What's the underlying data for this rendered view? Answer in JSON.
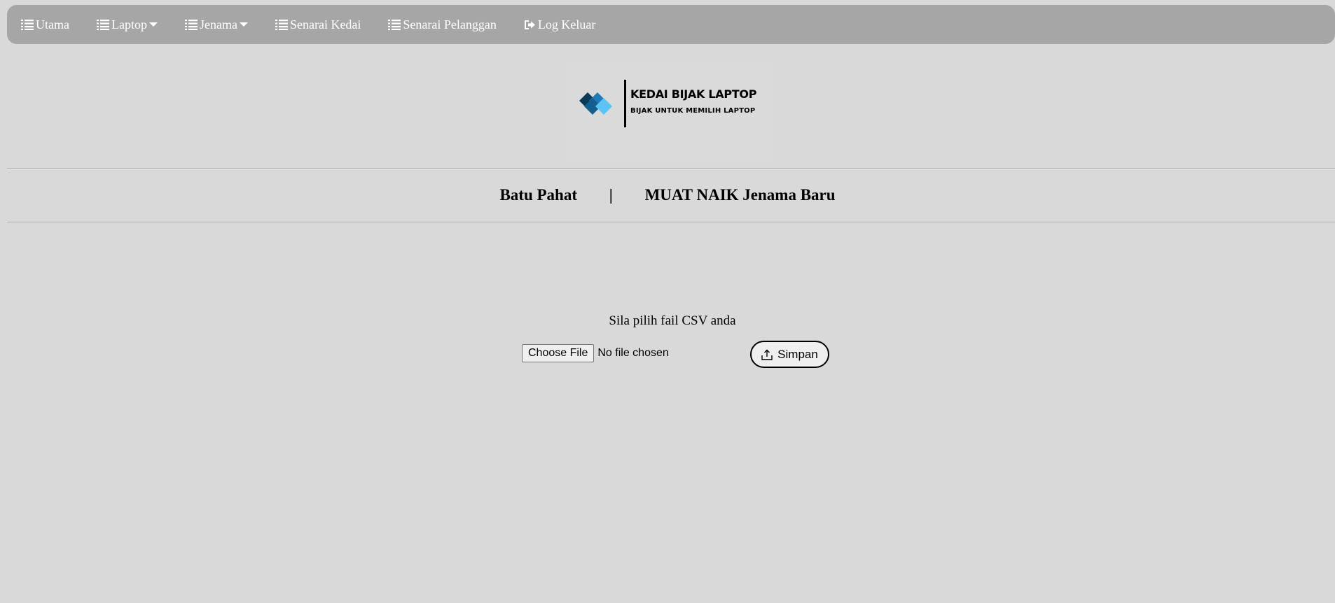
{
  "nav": {
    "items": [
      {
        "label": "Utama",
        "icon": "list-icon",
        "dropdown": false
      },
      {
        "label": "Laptop",
        "icon": "list-icon",
        "dropdown": true
      },
      {
        "label": "Jenama",
        "icon": "list-icon",
        "dropdown": true
      },
      {
        "label": "Senarai Kedai",
        "icon": "list-icon",
        "dropdown": false
      },
      {
        "label": "Senarai Pelanggan",
        "icon": "list-icon",
        "dropdown": false
      },
      {
        "label": "Log Keluar",
        "icon": "sign-out-icon",
        "dropdown": false
      }
    ]
  },
  "logo": {
    "title": "KEDAI BIJAK LAPTOP",
    "tagline": "BIJAK UNTUK MEMILIH LAPTOP"
  },
  "heading": {
    "location": "Batu Pahat",
    "separator": "|",
    "page_title": "MUAT NAIK Jenama Baru"
  },
  "upload": {
    "prompt": "Sila pilih fail CSV anda",
    "choose_label": "Choose File",
    "no_file_text": "No file chosen",
    "submit_label": "Simpan"
  },
  "colors": {
    "background": "#d9d9d9",
    "navbar": "#a6a6a6",
    "logo_dark": "#0b3a57",
    "logo_mid": "#1e7bb8",
    "logo_light": "#5bc4f5"
  }
}
